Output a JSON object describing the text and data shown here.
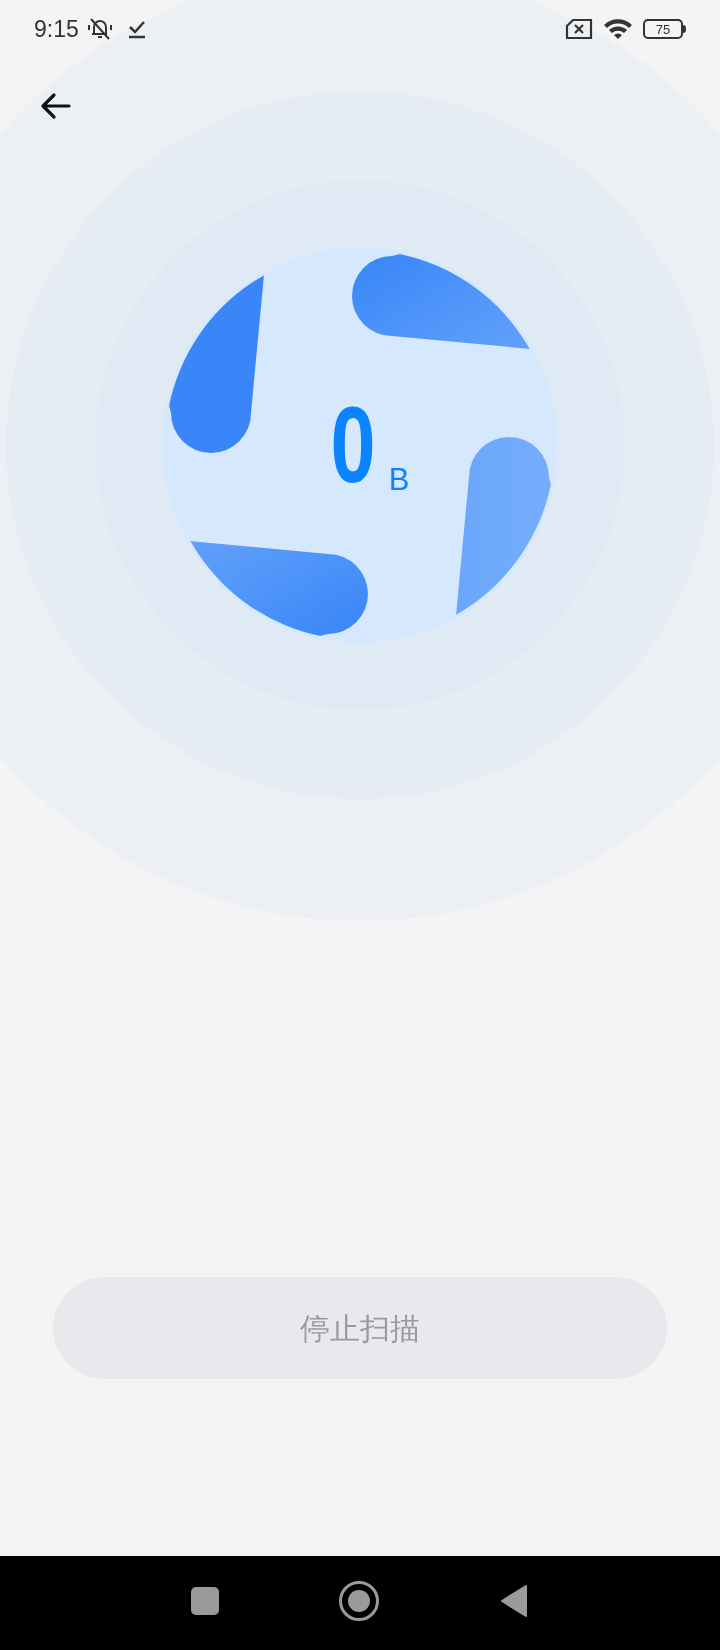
{
  "status_bar": {
    "time": "9:15",
    "battery": "75"
  },
  "scan": {
    "size_value": "0",
    "size_unit": "B"
  },
  "stop_button": {
    "label": "停止扫描"
  }
}
